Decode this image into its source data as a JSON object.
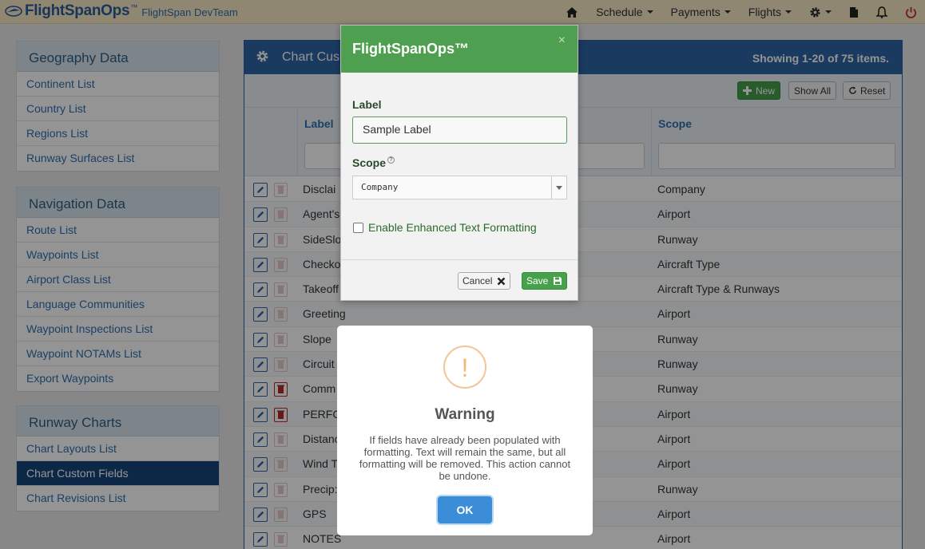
{
  "brand": {
    "name": "FlightSpanOps",
    "tm": "™",
    "team": "FlightSpan DevTeam"
  },
  "nav": {
    "schedule": "Schedule",
    "payments": "Payments",
    "flights": "Flights"
  },
  "sidebar": {
    "geography": {
      "title": "Geography Data",
      "items": [
        "Continent List",
        "Country List",
        "Regions List",
        "Runway Surfaces List"
      ]
    },
    "navigation": {
      "title": "Navigation Data",
      "items": [
        "Route List",
        "Waypoints List",
        "Airport Class List",
        "Language Communities",
        "Waypoint Inspections List",
        "Waypoint NOTAMs List",
        "Export Waypoints"
      ]
    },
    "runway": {
      "title": "Runway Charts",
      "items": [
        "Chart Layouts List",
        "Chart Custom Fields",
        "Chart Revisions List"
      ],
      "active_index": 1
    }
  },
  "main": {
    "title": "Chart Cus",
    "count": "Showing 1-20 of 75 items.",
    "buttons": {
      "new": "New",
      "show_all": "Show All",
      "reset": "Reset"
    },
    "columns": {
      "label": "Label",
      "scope": "Scope"
    },
    "rows": [
      {
        "label": "Disclai",
        "scope": "Company",
        "deletable": false
      },
      {
        "label": "Agent's",
        "scope": "Airport",
        "deletable": false
      },
      {
        "label": "SideSlo",
        "scope": "Runway",
        "deletable": false
      },
      {
        "label": "Checko",
        "scope": "Aircraft Type",
        "deletable": false
      },
      {
        "label": "Takeoff",
        "scope": "Aircraft Type & Runways",
        "deletable": false
      },
      {
        "label": "Greeting",
        "scope": "Airport",
        "deletable": false
      },
      {
        "label": "Slope",
        "scope": "Runway",
        "deletable": false
      },
      {
        "label": "Circuit",
        "scope": "Runway",
        "deletable": false
      },
      {
        "label": "Comm",
        "scope": "Runway",
        "deletable": true
      },
      {
        "label": "PERFC",
        "scope": "Airport",
        "deletable": true
      },
      {
        "label": "Distanc",
        "scope": "Airport",
        "deletable": false
      },
      {
        "label": "Wind T",
        "scope": "Airport",
        "deletable": false
      },
      {
        "label": "Precip:",
        "scope": "Runway",
        "deletable": false
      },
      {
        "label": "GPS",
        "scope": "Airport",
        "deletable": false
      },
      {
        "label": "NOTES",
        "scope": "Airport",
        "deletable": false
      }
    ]
  },
  "modal": {
    "title": "FlightSpanOps™",
    "close": "×",
    "label_field": {
      "label": "Label",
      "value": "Sample Label"
    },
    "scope_field": {
      "label": "Scope",
      "help": "?",
      "value": "Company"
    },
    "checkbox": {
      "label": "Enable Enhanced Text Formatting",
      "checked": false
    },
    "cancel": "Cancel",
    "save": "Save"
  },
  "warning": {
    "icon": "!",
    "title": "Warning",
    "text": "If fields have already been populated with formatting. Text will remain the same, but all formatting will be removed. This action cannot be undone.",
    "ok": "OK"
  }
}
